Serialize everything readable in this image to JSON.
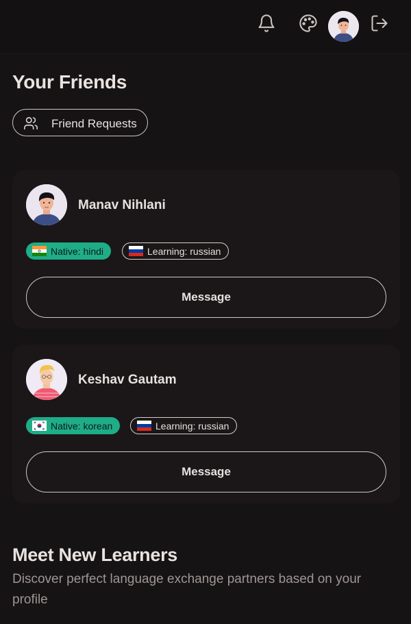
{
  "header": {
    "icons": [
      "bell-icon",
      "palette-icon",
      "avatar",
      "logout-icon"
    ]
  },
  "friends_section": {
    "title": "Your Friends",
    "requests_button": "Friend Requests"
  },
  "friends": [
    {
      "name": "Manav Nihlani",
      "native_label": "Native: hindi",
      "learning_label": "Learning: russian",
      "message_label": "Message"
    },
    {
      "name": "Keshav Gautam",
      "native_label": "Native: korean",
      "learning_label": "Learning: russian",
      "message_label": "Message"
    }
  ],
  "meet_section": {
    "title": "Meet New Learners",
    "subtitle": "Discover perfect language exchange partners based on your profile"
  },
  "colors": {
    "background": "#161314",
    "card": "#1b1718",
    "native_badge": "#1fad88"
  }
}
